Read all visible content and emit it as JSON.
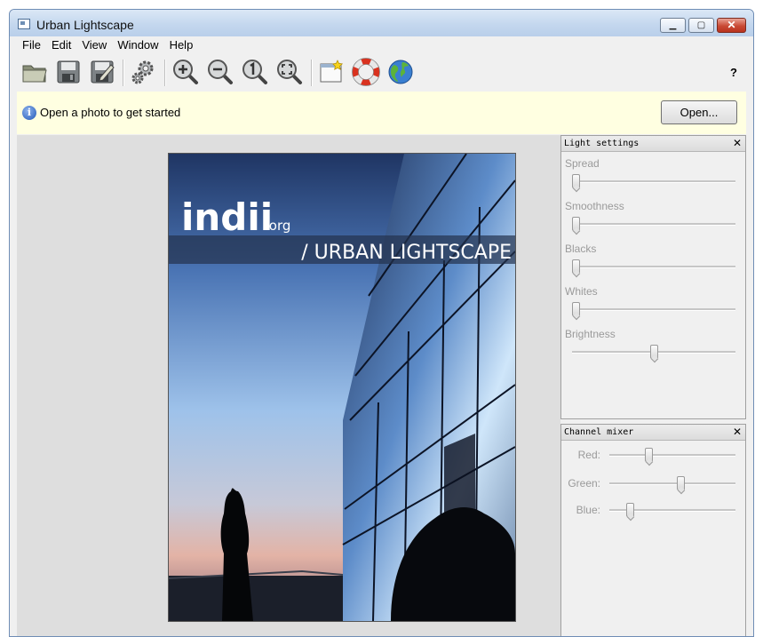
{
  "window": {
    "title": "Urban Lightscape",
    "min": "▁",
    "max": "▢",
    "close": "✕"
  },
  "menu": [
    "File",
    "Edit",
    "View",
    "Window",
    "Help"
  ],
  "toolbar": {
    "icons": [
      "open-folder-icon",
      "save-icon",
      "save-as-icon",
      "settings-gears-icon",
      "zoom-in-icon",
      "zoom-out-icon",
      "zoom-actual-size-icon",
      "zoom-fit-icon",
      "new-window-icon",
      "help-lifebuoy-icon",
      "website-globe-icon"
    ],
    "help": "?"
  },
  "infobar": {
    "message": "Open a photo to get started",
    "button": "Open..."
  },
  "photo": {
    "logo": "indii",
    "logo_suffix": ".org",
    "banner": "/ URBAN LIGHTSCAPE"
  },
  "light_settings": {
    "title": "Light settings",
    "close": "✕",
    "sliders": [
      {
        "label": "Spread",
        "value": 0
      },
      {
        "label": "Smoothness",
        "value": 0
      },
      {
        "label": "Blacks",
        "value": 0
      },
      {
        "label": "Whites",
        "value": 0
      },
      {
        "label": "Brightness",
        "value": 0.5
      }
    ]
  },
  "channel_mixer": {
    "title": "Channel mixer",
    "close": "✕",
    "sliders": [
      {
        "label": "Red:",
        "value": 0.3
      },
      {
        "label": "Green:",
        "value": 0.57
      },
      {
        "label": "Blue:",
        "value": 0.14
      }
    ]
  },
  "colors": {
    "infobar_bg": "#ffffe1",
    "title_bg": "#c4d7ee",
    "close_red": "#c94a35"
  }
}
